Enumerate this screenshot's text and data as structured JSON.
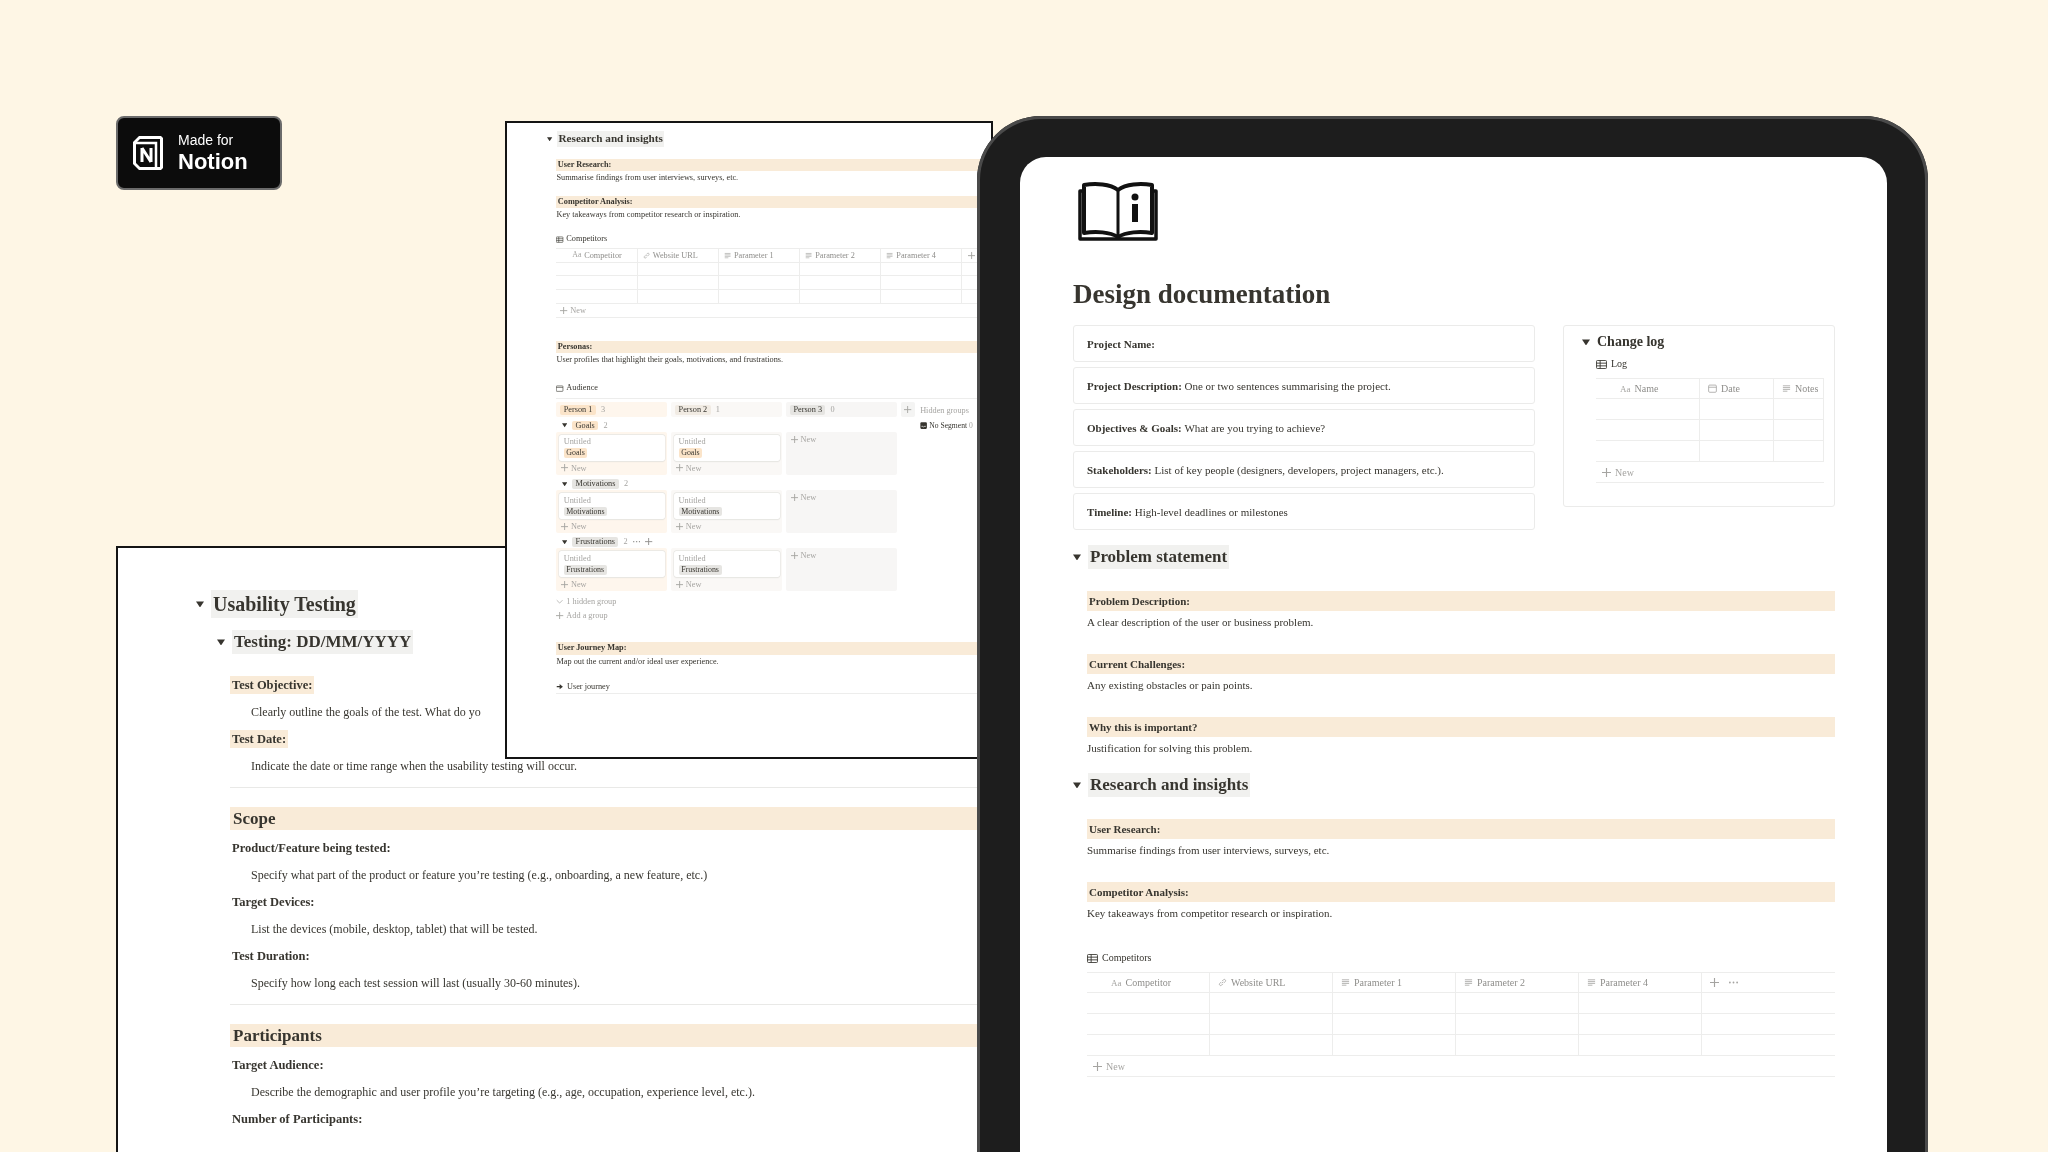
{
  "badge": {
    "line1": "Made for",
    "line2": "Notion"
  },
  "usability_page": {
    "title": "Usability Testing",
    "expanded": true,
    "test": {
      "title": "Testing: DD/MM/YYYY",
      "expanded": true
    },
    "blocks": [
      {
        "kind": "field",
        "label": "Test Objective:",
        "text": "Clearly outline the goals of the test. What do yo",
        "highlighted": true
      },
      {
        "kind": "field",
        "label": "Test Date:",
        "text": "Indicate the date or time range when the usability testing will occur.",
        "highlighted": true
      },
      {
        "kind": "section",
        "title": "Scope"
      },
      {
        "kind": "field",
        "label": "Product/Feature being tested:",
        "text": "Specify what part of the product or feature you’re testing (e.g., onboarding, a new feature, etc.)",
        "highlighted": false
      },
      {
        "kind": "field",
        "label": "Target Devices:",
        "text": "List the devices (mobile, desktop, tablet) that will be tested.",
        "highlighted": false
      },
      {
        "kind": "field",
        "label": "Test Duration:",
        "text": "Specify how long each test session will last (usually 30-60 minutes).",
        "highlighted": false
      },
      {
        "kind": "section",
        "title": "Participants"
      },
      {
        "kind": "field",
        "label": "Target Audience:",
        "text": "Describe the demographic and user profile you’re targeting (e.g., age, occupation, experience level, etc.).",
        "highlighted": false
      },
      {
        "kind": "field",
        "label": "Number of Participants:",
        "highlighted": false
      }
    ]
  },
  "research_page": {
    "title": "Research and insights",
    "expanded": true,
    "blocks": [
      {
        "kind": "callout",
        "label": "User Research:",
        "text": "Summarise findings from user interviews, surveys, etc."
      },
      {
        "kind": "callout",
        "label": "Competitor Analysis:",
        "text": "Key takeaways from competitor research or inspiration."
      },
      {
        "kind": "table",
        "name": "Competitors",
        "add_column": true,
        "columns": [
          {
            "label": "Competitor",
            "kind": "title",
            "icon_text": "Aa"
          },
          {
            "label": "Website URL",
            "kind": "url"
          },
          {
            "label": "Parameter 1",
            "kind": "text"
          },
          {
            "label": "Parameter 2",
            "kind": "text"
          },
          {
            "label": "Parameter 4",
            "kind": "text"
          }
        ],
        "new_label": "New"
      },
      {
        "kind": "callout",
        "label": "Personas:",
        "text": "User profiles that highlight their goals, motivations, and frustrations."
      },
      {
        "kind": "board",
        "name": "Audience",
        "columns": [
          {
            "label": "Person 1",
            "count": "3",
            "color": "#fbe4c9"
          },
          {
            "label": "Person 2",
            "count": "1",
            "color": "#f1ebe3"
          },
          {
            "label": "Person 3",
            "count": "0",
            "color": "#e6e5e2"
          }
        ],
        "hidden_label": "Hidden groups",
        "no_segment": {
          "label": "No Segment",
          "count": "0"
        },
        "groups": [
          {
            "label": "Goals",
            "count": "2",
            "color": "#fbe4c9",
            "expanded": true,
            "hovered": false,
            "cells": [
              {
                "cards": [
                  {
                    "title": "Untitled",
                    "tag": "Goals"
                  }
                ],
                "new_label": "New"
              },
              {
                "cards": [
                  {
                    "title": "Untitled",
                    "tag": "Goals"
                  }
                ],
                "new_label": "New"
              },
              {
                "new_label": "New"
              }
            ]
          },
          {
            "label": "Motivations",
            "count": "2",
            "color": "#e6e5e2",
            "expanded": true,
            "hovered": false,
            "cells": [
              {
                "cards": [
                  {
                    "title": "Untitled",
                    "tag": "Motivations"
                  }
                ],
                "new_label": "New"
              },
              {
                "cards": [
                  {
                    "title": "Untitled",
                    "tag": "Motivations"
                  }
                ],
                "new_label": "New"
              },
              {
                "new_label": "New"
              }
            ]
          },
          {
            "label": "Frustrations",
            "count": "2",
            "color": "#e6e5e2",
            "expanded": true,
            "hovered": true,
            "cells": [
              {
                "cards": [
                  {
                    "title": "Untitled",
                    "tag": "Frustrations"
                  }
                ],
                "new_label": "New"
              },
              {
                "cards": [
                  {
                    "title": "Untitled",
                    "tag": "Frustrations"
                  }
                ],
                "new_label": "New"
              },
              {
                "new_label": "New"
              }
            ]
          }
        ],
        "hidden_group": "1 hidden group",
        "add_group": "Add a group"
      },
      {
        "kind": "callout",
        "label": "User Journey Map:",
        "text": "Map out the current and/or ideal user experience."
      },
      {
        "kind": "link",
        "label": "User journey"
      }
    ]
  },
  "design_page": {
    "title": "Design documentation",
    "properties": [
      {
        "label": "Project Name:"
      },
      {
        "label": "Project Description:",
        "text": "One or two sentences summarising the project."
      },
      {
        "label": "Objectives & Goals:",
        "text": "What are you trying to achieve?"
      },
      {
        "label": "Stakeholders:",
        "text": "List of key people (designers, developers, project managers, etc.)."
      },
      {
        "label": "Timeline:",
        "text": "High-level deadlines or milestones"
      }
    ],
    "change_log": {
      "title": "Change log",
      "expanded": true,
      "table": {
        "name": "Log",
        "columns": [
          {
            "label": "Name",
            "kind": "title",
            "icon_text": "Aa"
          },
          {
            "label": "Date",
            "kind": "date"
          },
          {
            "label": "Notes",
            "kind": "text"
          }
        ],
        "new_label": "New"
      }
    },
    "sections": [
      {
        "title": "Problem statement",
        "expanded": true,
        "blocks": [
          {
            "kind": "callout",
            "label": "Problem Description:",
            "text": "A clear description of the user or business problem."
          },
          {
            "kind": "callout",
            "label": "Current Challenges:",
            "text": "Any existing obstacles or pain points."
          },
          {
            "kind": "callout",
            "label": "Why this is important?",
            "text": "Justification for solving this problem."
          }
        ]
      },
      {
        "title": "Research and insights",
        "expanded": true,
        "blocks": [
          {
            "kind": "callout",
            "label": "User Research:",
            "text": "Summarise findings from user interviews, surveys, etc."
          },
          {
            "kind": "callout",
            "label": "Competitor Analysis:",
            "text": "Key takeaways from competitor research or inspiration."
          },
          {
            "kind": "table",
            "name": "Competitors",
            "add_column": true,
            "more": true,
            "columns": [
              {
                "label": "Competitor",
                "kind": "title",
                "icon_text": "Aa"
              },
              {
                "label": "Website URL",
                "kind": "url"
              },
              {
                "label": "Parameter 1",
                "kind": "text"
              },
              {
                "label": "Parameter 2",
                "kind": "text"
              },
              {
                "label": "Parameter 4",
                "kind": "text"
              }
            ],
            "new_label": "New"
          }
        ]
      }
    ]
  }
}
